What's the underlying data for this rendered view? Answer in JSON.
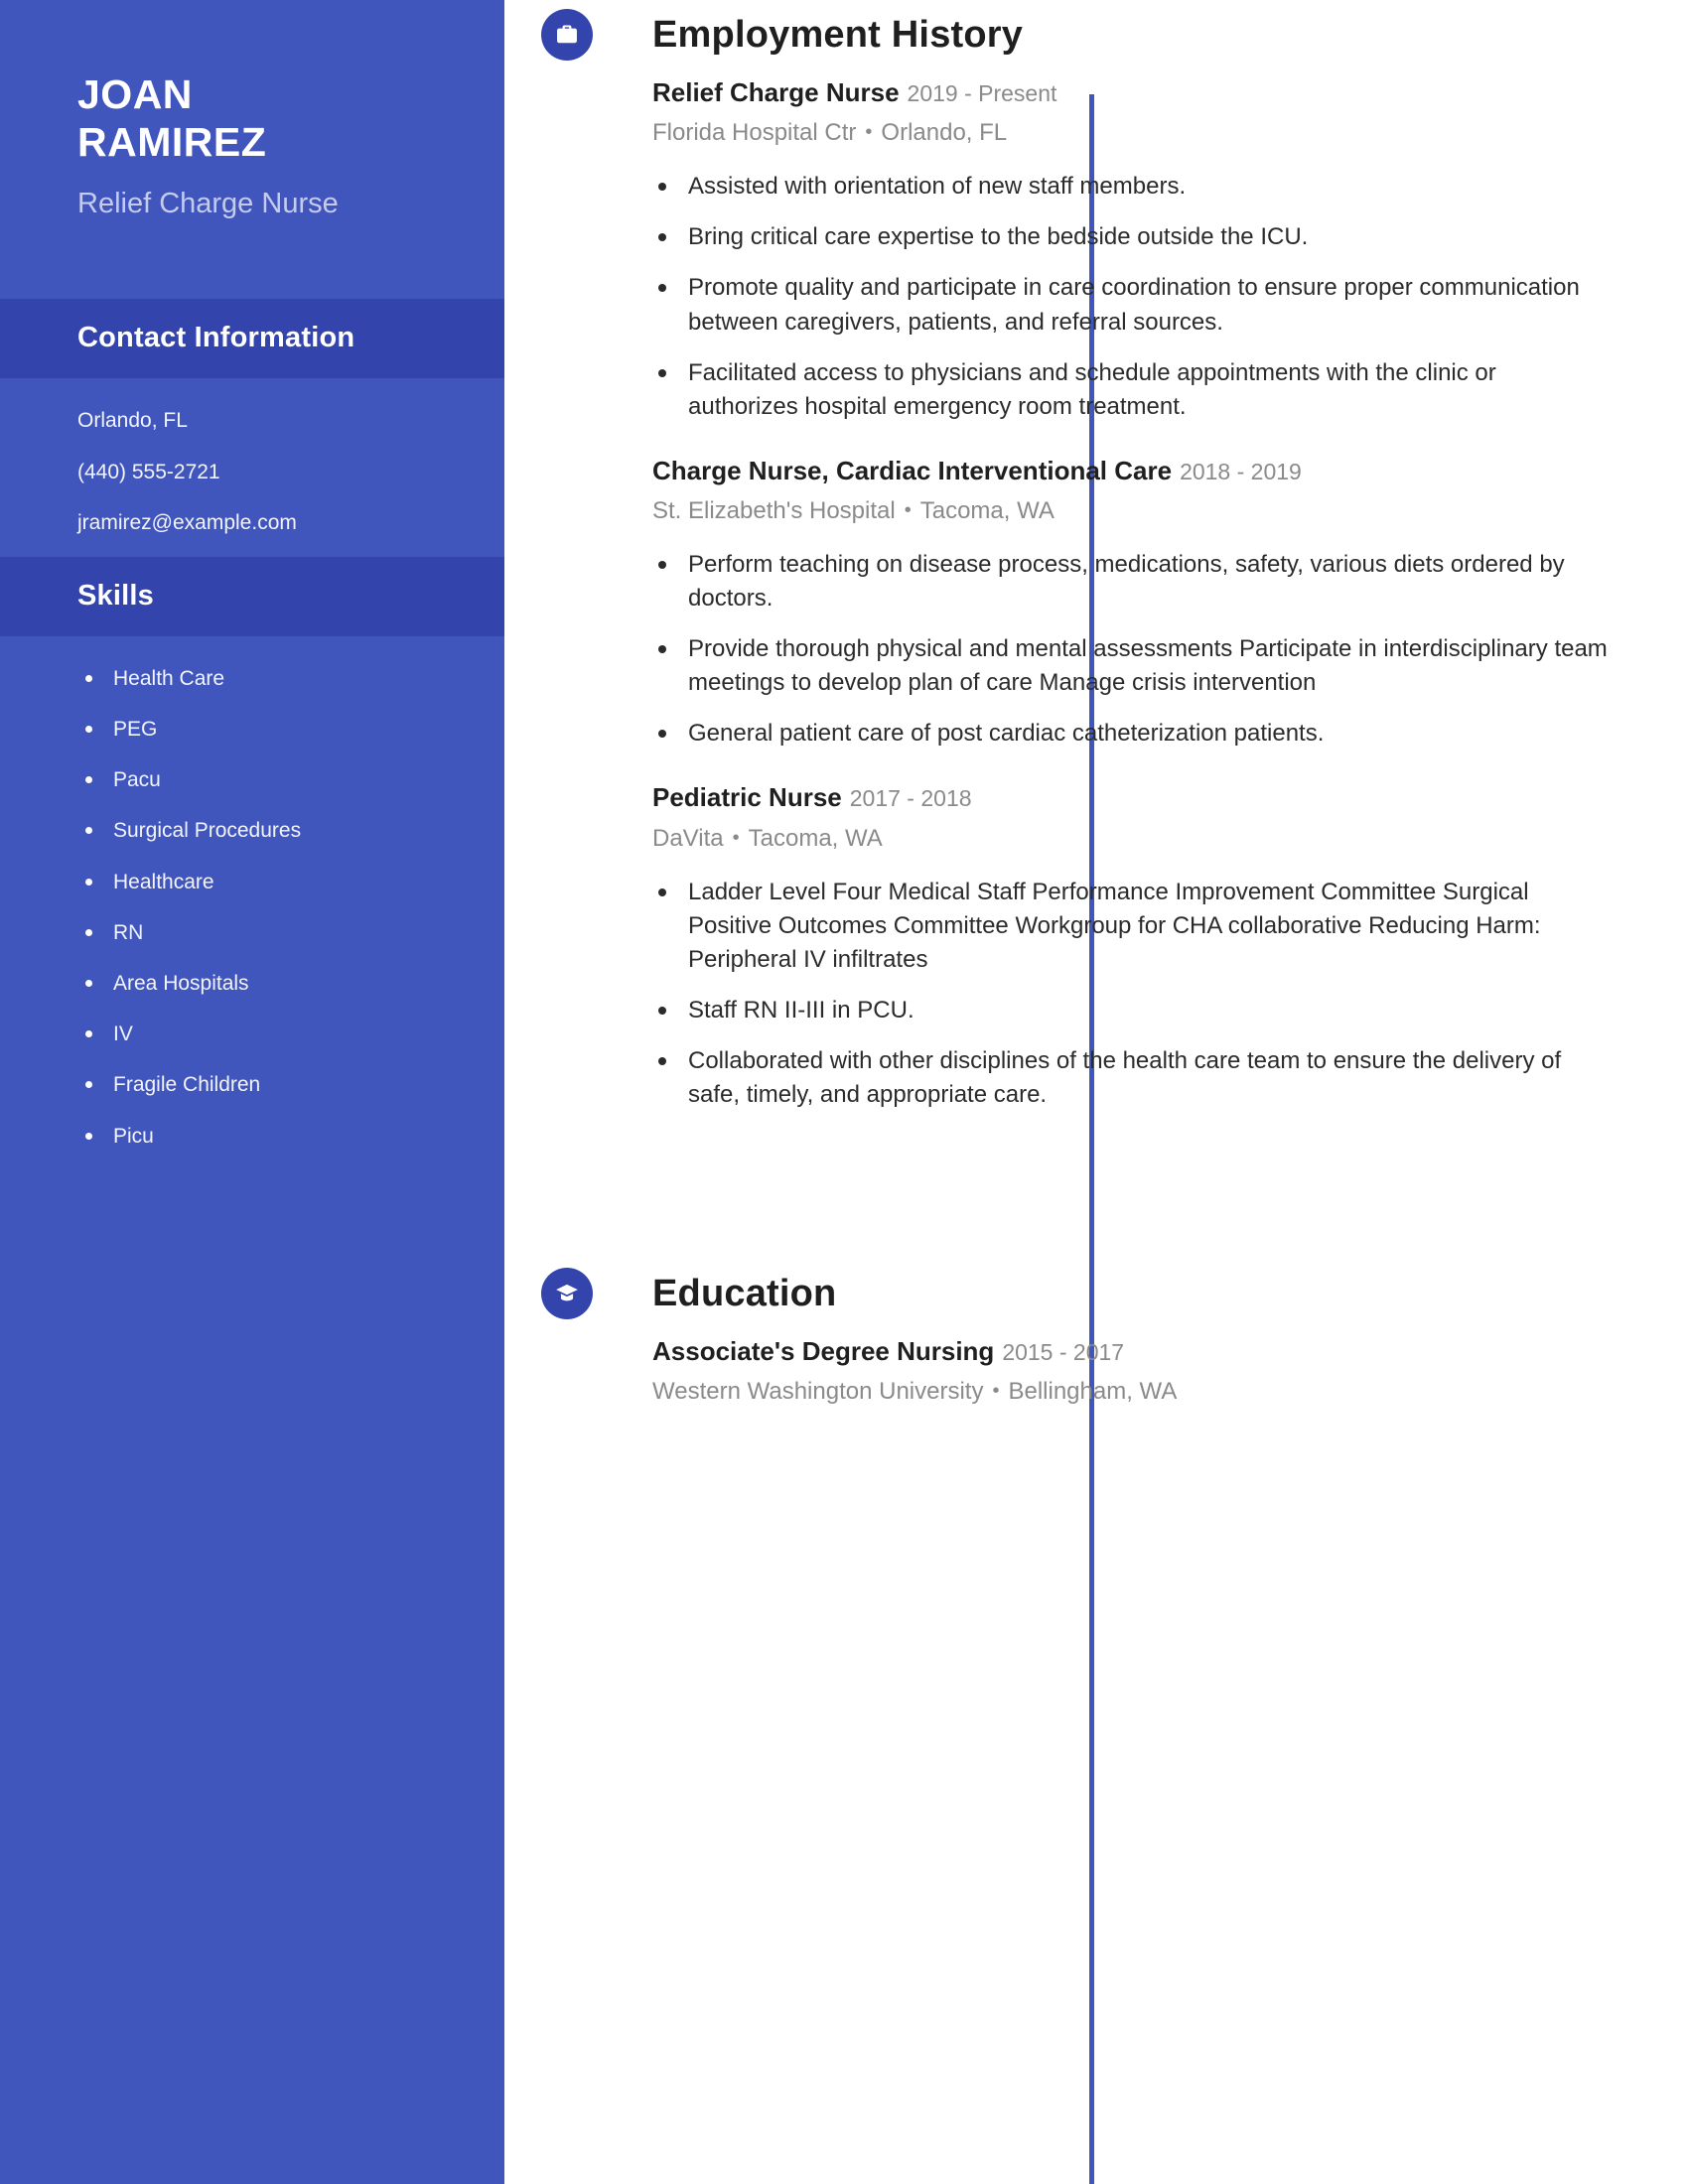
{
  "theme": {
    "sidebar_bg": "#4156bd",
    "sidebar_band_bg": "#3444ad",
    "accent": "#3444ad",
    "page_bg": "#ffffff",
    "muted_text": "#8a8a8a",
    "body_text": "#2b2b2b"
  },
  "sidebar": {
    "first_name": "JOAN",
    "last_name": "RAMIREZ",
    "job_title": "Relief Charge Nurse",
    "contact": {
      "heading": "Contact Information",
      "location": "Orlando, FL",
      "phone": "(440) 555-2721",
      "email": "jramirez@example.com"
    },
    "skills": {
      "heading": "Skills",
      "items": [
        "Health Care",
        "PEG",
        "Pacu",
        "Surgical Procedures",
        "Healthcare",
        "RN",
        "Area Hospitals",
        "IV",
        "Fragile Children",
        "Picu"
      ]
    }
  },
  "employment": {
    "heading": "Employment History",
    "icon": "briefcase-icon",
    "entries": [
      {
        "title": "Relief Charge Nurse",
        "dates": "2019 - Present",
        "company": "Florida Hospital Ctr",
        "location": "Orlando, FL",
        "bullets": [
          "Assisted with orientation of new staff members.",
          "Bring critical care expertise to the bedside outside the ICU.",
          "Promote quality and participate in care coordination to ensure proper communication between caregivers, patients, and referral sources.",
          "Facilitated access to physicians and schedule appointments with the clinic or authorizes hospital emergency room treatment."
        ]
      },
      {
        "title": "Charge Nurse, Cardiac Interventional Care",
        "dates": "2018 - 2019",
        "company": "St. Elizabeth's Hospital",
        "location": "Tacoma, WA",
        "bullets": [
          "Perform teaching on disease process, medications, safety, various diets ordered by doctors.",
          "Provide thorough physical and mental assessments Participate in interdisciplinary team meetings to develop plan of care Manage crisis intervention",
          "General patient care of post cardiac catheterization patients."
        ]
      },
      {
        "title": "Pediatric Nurse",
        "dates": "2017 - 2018",
        "company": "DaVita",
        "location": "Tacoma, WA",
        "bullets": [
          "Ladder Level Four Medical Staff Performance Improvement Committee Surgical Positive Outcomes Committee Workgroup for CHA collaborative Reducing Harm: Peripheral IV infiltrates",
          "Staff RN II-III in PCU.",
          "Collaborated with other disciplines of the health care team to ensure the delivery of safe, timely, and appropriate care."
        ]
      }
    ]
  },
  "education": {
    "heading": "Education",
    "icon": "graduation-cap-icon",
    "entries": [
      {
        "title": "Associate's Degree Nursing",
        "dates": "2015 - 2017",
        "school": "Western Washington University",
        "location": "Bellingham, WA"
      }
    ]
  },
  "separator": "•"
}
